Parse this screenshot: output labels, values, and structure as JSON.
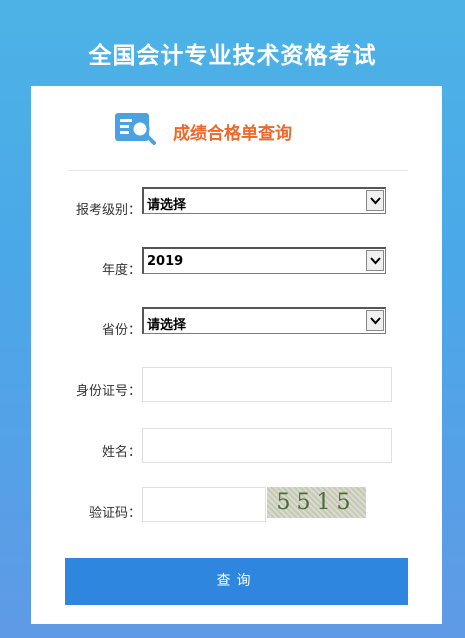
{
  "page": {
    "title": "全国会计专业技术资格考试"
  },
  "header": {
    "title": "成绩合格单查询",
    "icon": "search-document-icon"
  },
  "form": {
    "level": {
      "label": "报考级别：",
      "value": "请选择"
    },
    "year": {
      "label": "年度：",
      "value": "2019"
    },
    "province": {
      "label": "省份：",
      "value": "请选择"
    },
    "id_number": {
      "label": "身份证号：",
      "value": ""
    },
    "name": {
      "label": "姓名：",
      "value": ""
    },
    "captcha": {
      "label": "验证码：",
      "value": "",
      "image_text": "5515"
    }
  },
  "submit": {
    "label": "查询"
  },
  "colors": {
    "accent": "#2f86de",
    "header_title": "#f0672a"
  }
}
